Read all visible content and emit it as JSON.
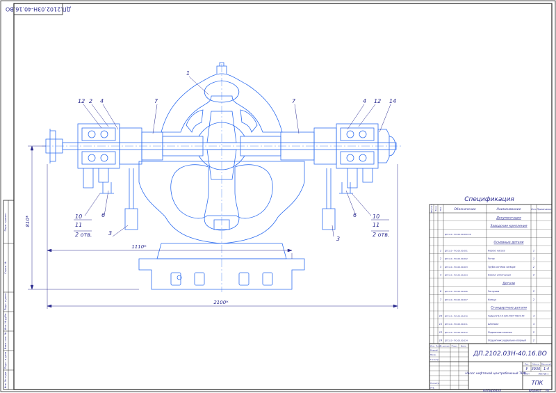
{
  "sheet": {
    "corner_code": "ДП.2102.03Н-40.16.ВО",
    "paper_label": "Копировал",
    "format_label": "Формат",
    "format_value": "A1"
  },
  "drawing": {
    "callouts": [
      "1",
      "2",
      "3",
      "4",
      "6",
      "7",
      "10",
      "11",
      "12",
      "14"
    ],
    "qty_note": "2 отв.",
    "dim_height": "810*",
    "dim_width_inner": "1110*",
    "dim_width_total": "2100*"
  },
  "spec": {
    "title": "Спецификация",
    "headers": {
      "format": "Формат",
      "zone": "Зона",
      "pos": "Поз.",
      "designation": "Обозначение",
      "name": "Наименование",
      "qty": "Кол.",
      "note": "Примечание"
    },
    "rows": [
      {
        "kind": "section",
        "name": "Документация"
      },
      {
        "kind": "section",
        "name": "Заводские крепления"
      },
      {
        "kind": "item",
        "pos": "",
        "designation": "ДП.110 - ПО.00.00.000 СБ",
        "name": "",
        "qty": ""
      },
      {
        "kind": "section",
        "name": "Основные детали"
      },
      {
        "kind": "item",
        "pos": "1",
        "designation": "ДП.110 - ПО.00.00.001",
        "name": "Корпус насоса",
        "qty": "1"
      },
      {
        "kind": "item",
        "pos": "2",
        "designation": "ДП.110 - ПО.00.00.002",
        "name": "Ротор",
        "qty": "1"
      },
      {
        "kind": "item",
        "pos": "3",
        "designation": "ДП.110 - ПО.00.00.003",
        "name": "Труба системы затвора",
        "qty": "2"
      },
      {
        "kind": "item",
        "pos": "4",
        "designation": "ДП.110 - ПО.00.00.004",
        "name": "Корпус уплотнения",
        "qty": "2"
      },
      {
        "kind": "section",
        "name": "Детали"
      },
      {
        "kind": "item",
        "pos": "6",
        "designation": "ДП.110 - ПО.00.00.006",
        "name": "Заглушка",
        "qty": "2"
      },
      {
        "kind": "item",
        "pos": "7",
        "designation": "ДП.110 - ПО.00.00.007",
        "name": "Кольцо",
        "qty": "2"
      },
      {
        "kind": "section",
        "name": "Стандартные детали"
      },
      {
        "kind": "item",
        "pos": "10",
        "designation": "ДП.110 - ПО.00.00.010",
        "name": "Гайка М 12.5.136 ГОСТ 5915-70",
        "qty": "4"
      },
      {
        "kind": "item",
        "pos": "11",
        "designation": "ДП.110 - ПО.00.00.011",
        "name": "Шпилька",
        "qty": "4"
      },
      {
        "kind": "item",
        "pos": "12",
        "designation": "ДП.110 - ПО.00.00.012",
        "name": "Подшипник качения",
        "qty": "2"
      },
      {
        "kind": "item",
        "pos": "14",
        "designation": "ДП.110 - ПО.00.00.014",
        "name": "Подшипник радиально-упорный",
        "qty": "2"
      }
    ]
  },
  "title_block": {
    "doc_code": "ДП.2102.03Н-40.16.ВО",
    "name": "Насос нефтяной центробежный ТВФ",
    "org": "ТПК",
    "lit_label": "Лит.",
    "mass_label": "Масса",
    "scale_label": "Масштаб",
    "lit": "У",
    "mass": "3930",
    "scale": "1:4",
    "sheet_label": "Лист",
    "sheets_label": "Листов 1",
    "left_rows": [
      "Изм. Лист",
      "Разраб.",
      "Пров.",
      "Т.контр.",
      "",
      "Н.контр.",
      "Утв."
    ],
    "col_labels": [
      "№ докум.",
      "Подп.",
      "Дата"
    ]
  },
  "margin_stamp": {
    "cells": [
      "Перв. примен.",
      "Справ. №",
      "Подп. и дата",
      "Инв. № дубл.",
      "Взам. инв. №",
      "Подп. и дата",
      "Инв. № подл."
    ]
  }
}
